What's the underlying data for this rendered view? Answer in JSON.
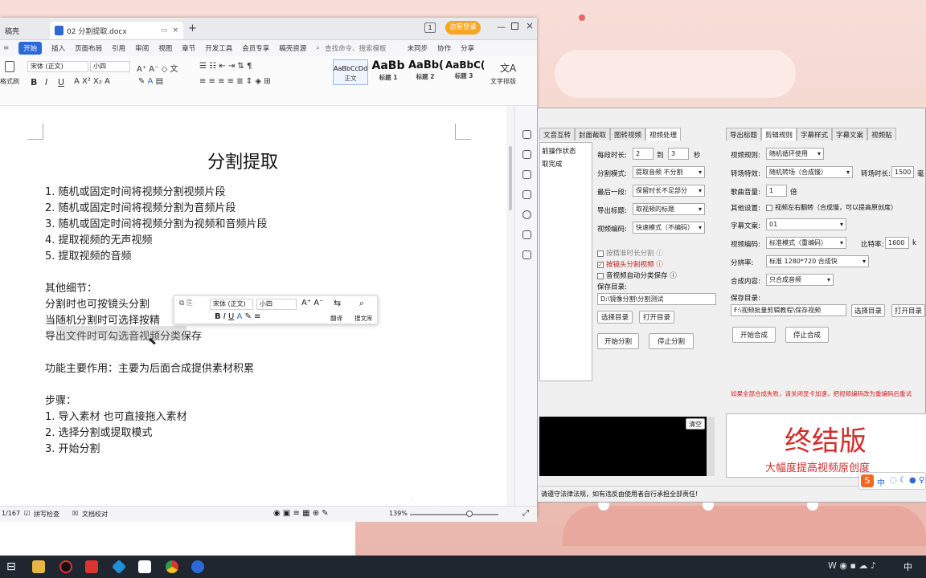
{
  "wps": {
    "prev_tab": "稿壳",
    "tab_title": "02 分割提取.docx",
    "tab_close": "×",
    "tab_add": "+",
    "page_num": "1",
    "visitor_btn": "访客登录",
    "menu": [
      "开始",
      "插入",
      "页面布局",
      "引用",
      "审阅",
      "视图",
      "章节",
      "开发工具",
      "会员专享",
      "稿壳资源"
    ],
    "search": "查找命令、搜索模板",
    "unsynced": "未同步",
    "collab": "协作",
    "share": "分享",
    "ribbon": {
      "format_brush": "格式刷",
      "font_name": "宋体 (正文)",
      "font_size": "小四",
      "styles": [
        {
          "preview": "AaBbCcDd",
          "name": "正文"
        },
        {
          "preview": "AaBb",
          "name": "标题 1"
        },
        {
          "preview": "AaBb(",
          "name": "标题 2"
        },
        {
          "preview": "AaBbC(",
          "name": "标题 3"
        }
      ],
      "text_layout": "文字排版"
    },
    "doc": {
      "title": "分割提取",
      "lines": [
        "1. 随机或固定时间将视频分割视频片段",
        "2. 随机或固定时间将视频分割为音频片段",
        "3. 随机或固定时间将视频分割为视频和音频片段",
        "4. 提取视频的无声视频",
        "5. 提取视频的音频",
        "",
        "其他细节：",
        "分割时也可按镜头分割",
        "当随机分割时可选择按精",
        "导出文件时可勾选音视频分类保存",
        "",
        "功能主要作用：主要为后面合成提供素材积累",
        "",
        "步骤：",
        "1. 导入素材  也可直接拖入素材",
        "2. 选择分割或提取模式",
        "3. 开始分割"
      ]
    },
    "minibar": {
      "font_name": "宋体 (正文)",
      "font_size": "小四",
      "translate": "翻译",
      "search_lib": "搜文库"
    },
    "status": {
      "page": "1/167",
      "spell": "拼写检查",
      "proof": "文档校对",
      "zoom": "139%"
    }
  },
  "tool": {
    "left_tabs": [
      "文音互转",
      "封面截取",
      "图转视频",
      "视频处理"
    ],
    "right_tabs": [
      "导出标题",
      "剪辑规则",
      "字幕样式",
      "字幕文案",
      "视频贴"
    ],
    "log": [
      "前操作状态",
      "取完成"
    ],
    "split": {
      "duration_label": "每段时长:",
      "duration_from": "2",
      "to": "到",
      "duration_to": "3",
      "sec": "秒",
      "mode_label": "分割模式:",
      "mode": "提取音频 不分割",
      "last_label": "最后一段:",
      "last": "保留时长不足部分",
      "title_label": "导出标题:",
      "title": "取视频的标题",
      "codec_label": "视频编码:",
      "codec": "快速模式（不编码）",
      "opt1": "按精准时长分割",
      "opt2": "按镜头分割视频",
      "opt3": "音视频自动分类保存",
      "save_label": "保存目录:",
      "save_path": "D:\\镜像分割\\分割测试",
      "choose_dir": "选择目录",
      "open_dir": "打开目录",
      "start": "开始分割",
      "stop": "停止分割"
    },
    "clear_btn": "清空",
    "compose": {
      "rule_label": "视频规则:",
      "rule": "随机循环使用",
      "trans_label": "转场特效:",
      "trans": "随机转场（合成慢）",
      "trans_time_label": "转场时长:",
      "trans_time": "1500",
      "trans_unit": "毫",
      "vol_label": "歌曲音量:",
      "vol": "1",
      "vol_unit": "倍",
      "other_label": "其他设置:",
      "flip": "视频左右翻转（合成慢，可以提高原创度）",
      "sub_label": "字幕文案:",
      "sub": "01",
      "codec_label": "视频编码:",
      "codec": "标准模式（重编码）",
      "bitrate_label": "比特率:",
      "bitrate": "1600",
      "bitrate_unit": "k",
      "res_label": "分辨率:",
      "res": "标准 1280*720 合成快",
      "content_label": "合成内容:",
      "content": "只合成音频",
      "save_label": "保存目录:",
      "save_path": "F:\\视频批量剪辑教程\\保存视频",
      "choose_dir": "选择目录",
      "open_dir": "打开目录",
      "start": "开始合成",
      "stop": "停止合成",
      "warn": "如果全部合成失败，请关闭显卡加速，把视频编码改为重编码后重试"
    },
    "promo_title": "终结版",
    "promo_sub": "大幅度提高视频原创度",
    "footer": "请遵守法律法规，如有违反由使用者自行承担全部责任!"
  },
  "overlay_caption": "视频添加字幕",
  "ime": "中",
  "colors": {
    "accent": "#2b6ad6",
    "promo": "#d22c2c",
    "caption": "#c41a1a"
  }
}
